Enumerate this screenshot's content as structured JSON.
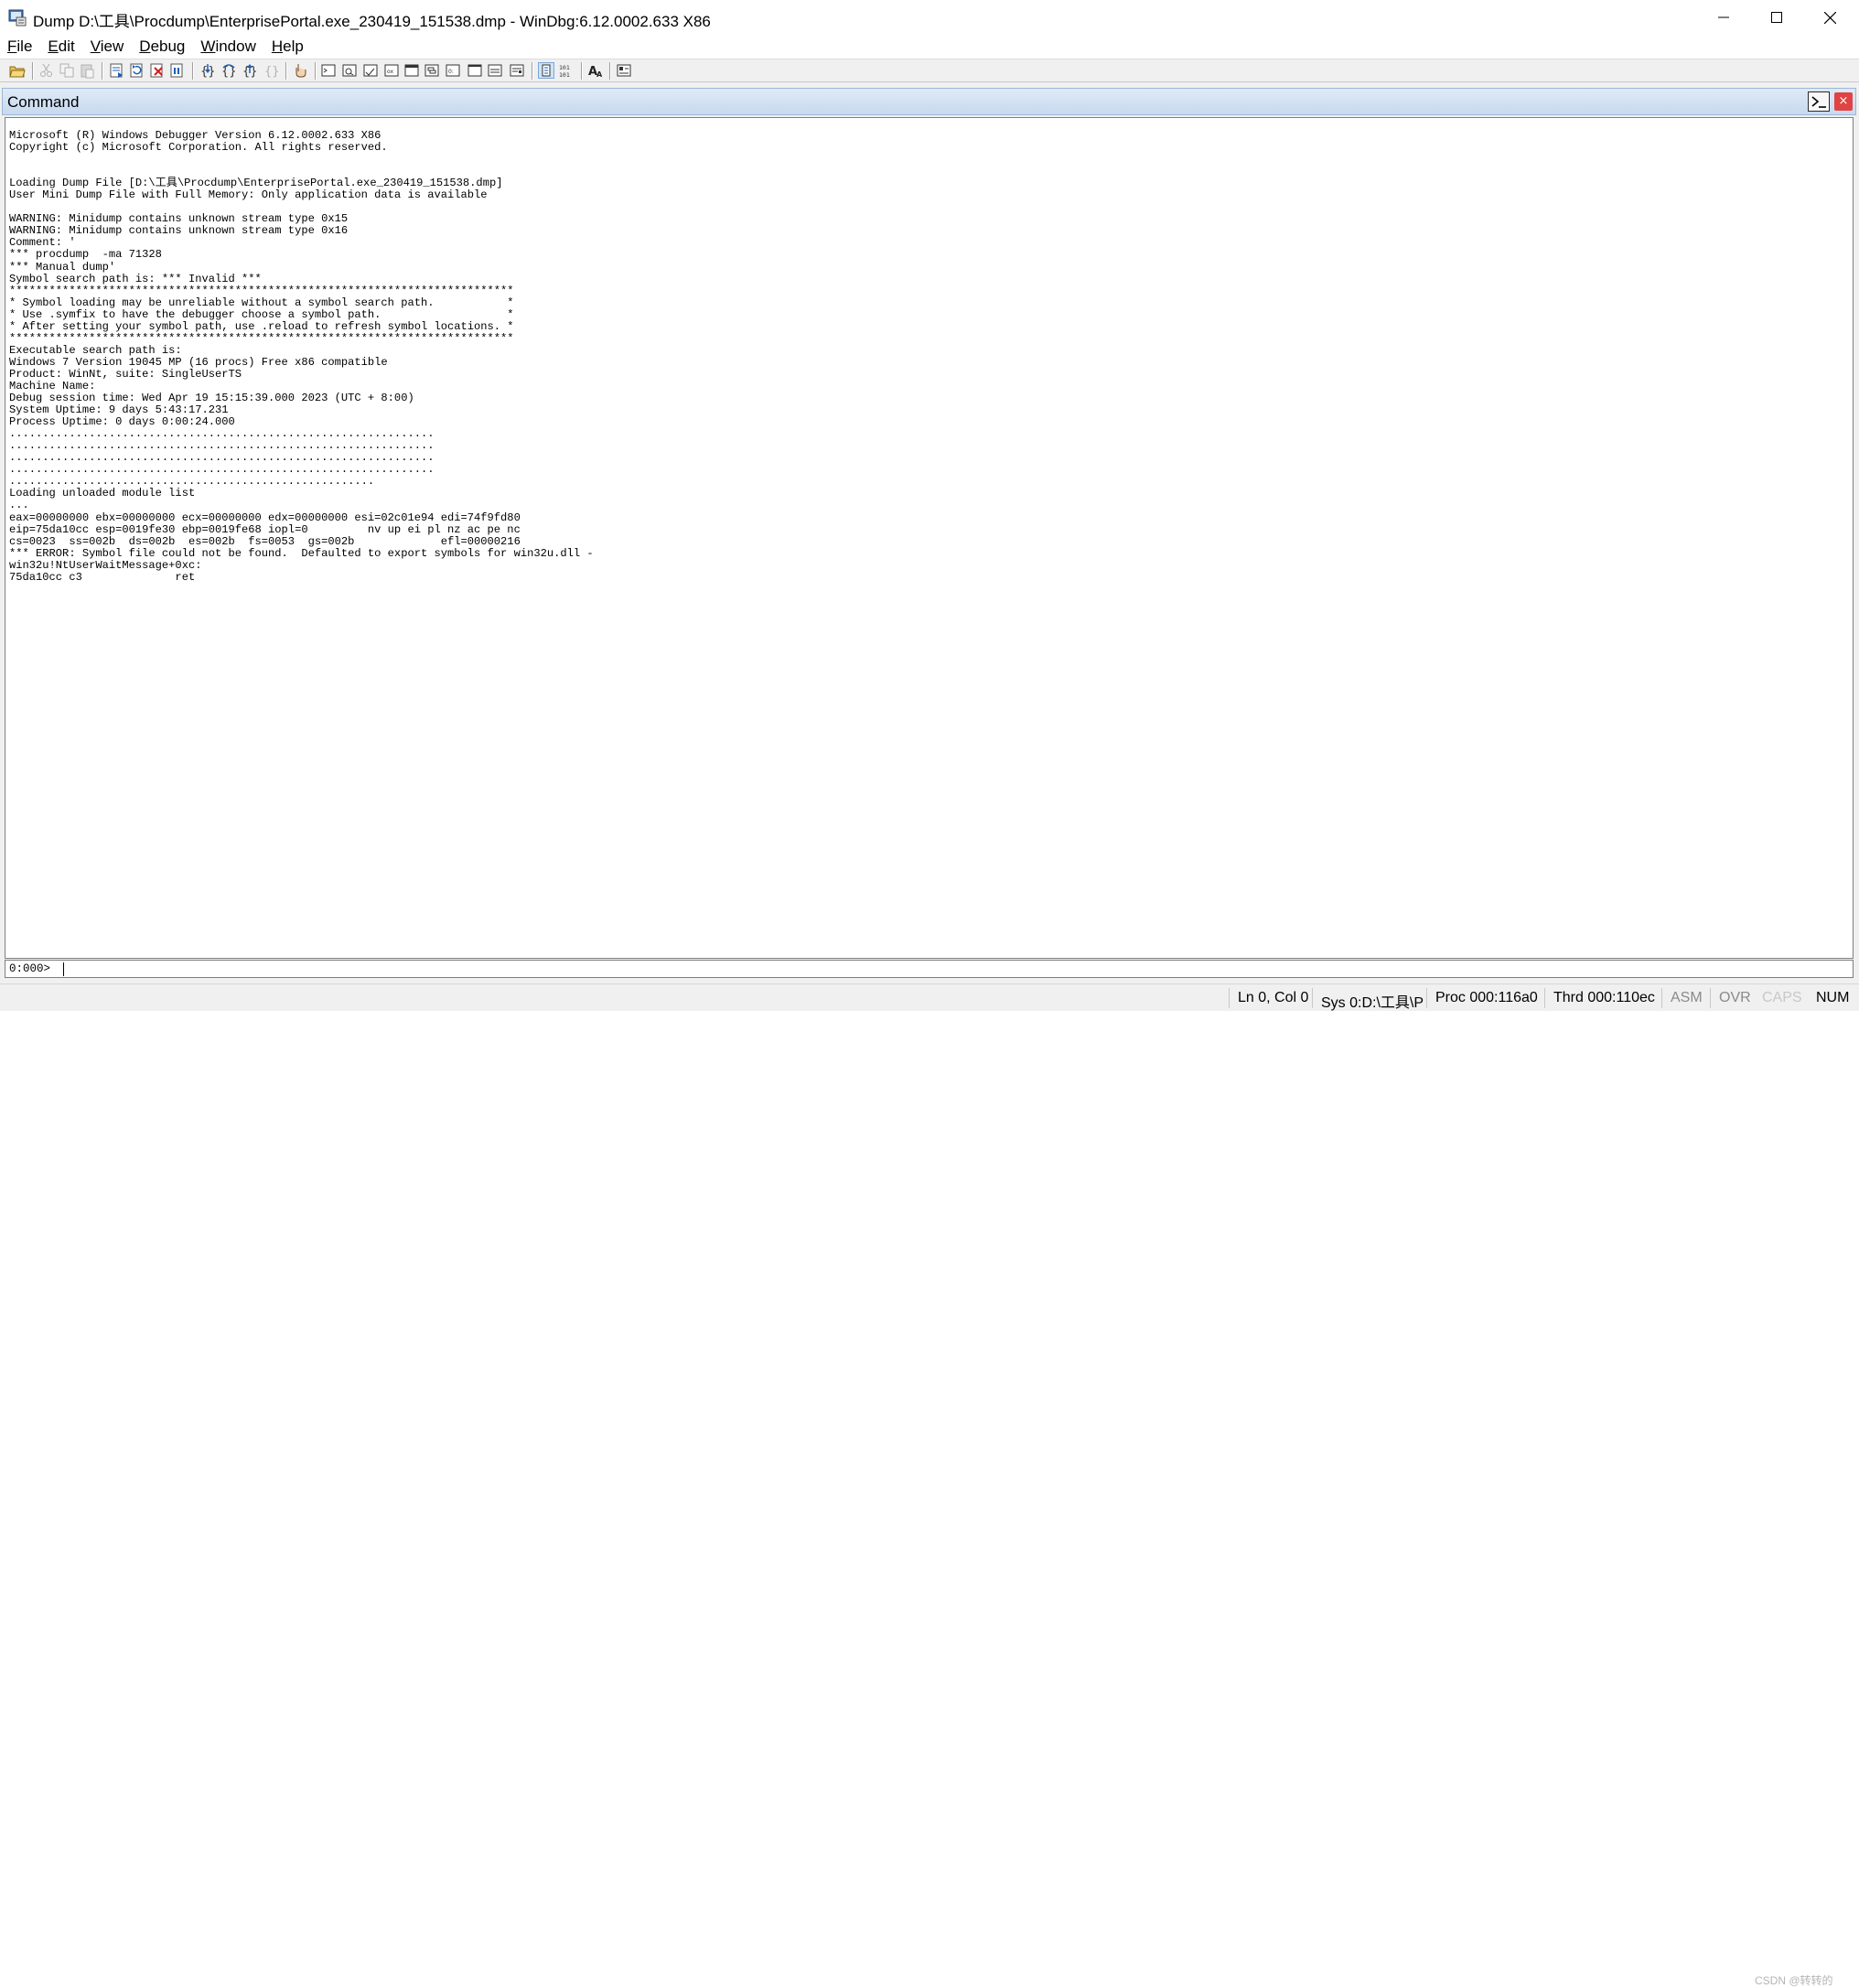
{
  "window": {
    "title": "Dump D:\\工具\\Procdump\\EnterprisePortal.exe_230419_151538.dmp - WinDbg:6.12.0002.633 X86"
  },
  "menu": [
    {
      "mnemonic": "F",
      "rest": "ile"
    },
    {
      "mnemonic": "E",
      "rest": "dit"
    },
    {
      "mnemonic": "V",
      "rest": "iew"
    },
    {
      "mnemonic": "D",
      "rest": "ebug"
    },
    {
      "mnemonic": "W",
      "rest": "indow"
    },
    {
      "mnemonic": "H",
      "rest": "elp"
    }
  ],
  "toolbar_icons": [
    "open-file-icon",
    "cut-icon",
    "copy-icon",
    "paste-icon",
    "go-icon",
    "restart-icon",
    "stop-debugging-icon",
    "break-icon",
    "step-into-icon",
    "step-over-icon",
    "step-out-icon",
    "run-to-cursor-icon",
    "insert-breakpoint-icon",
    "command-window-icon",
    "watch-window-icon",
    "locals-window-icon",
    "registers-window-icon",
    "memory-window-icon",
    "call-stack-window-icon",
    "disassembly-window-icon",
    "scratch-pad-icon",
    "processes-threads-icon",
    "source-mode-icon",
    "hex-mode-icon",
    "font-icon",
    "options-icon"
  ],
  "command_window": {
    "title": "Command",
    "close_glyph": "×",
    "output_lines": [
      "Microsoft (R) Windows Debugger Version 6.12.0002.633 X86",
      "Copyright (c) Microsoft Corporation. All rights reserved.",
      "",
      "",
      "Loading Dump File [D:\\工具\\Procdump\\EnterprisePortal.exe_230419_151538.dmp]",
      "User Mini Dump File with Full Memory: Only application data is available",
      "",
      "WARNING: Minidump contains unknown stream type 0x15",
      "WARNING: Minidump contains unknown stream type 0x16",
      "Comment: '",
      "*** procdump  -ma 71328",
      "*** Manual dump'",
      "Symbol search path is: *** Invalid ***",
      "****************************************************************************",
      "* Symbol loading may be unreliable without a symbol search path.           *",
      "* Use .symfix to have the debugger choose a symbol path.                   *",
      "* After setting your symbol path, use .reload to refresh symbol locations. *",
      "****************************************************************************",
      "Executable search path is:",
      "Windows 7 Version 19045 MP (16 procs) Free x86 compatible",
      "Product: WinNt, suite: SingleUserTS",
      "Machine Name:",
      "Debug session time: Wed Apr 19 15:15:39.000 2023 (UTC + 8:00)",
      "System Uptime: 9 days 5:43:17.231",
      "Process Uptime: 0 days 0:00:24.000",
      "................................................................",
      "................................................................",
      "................................................................",
      "................................................................",
      ".......................................................",
      "Loading unloaded module list",
      "...",
      "eax=00000000 ebx=00000000 ecx=00000000 edx=00000000 esi=02c01e94 edi=74f9fd80",
      "eip=75da10cc esp=0019fe30 ebp=0019fe68 iopl=0         nv up ei pl nz ac pe nc",
      "cs=0023  ss=002b  ds=002b  es=002b  fs=0053  gs=002b             efl=00000216",
      "*** ERROR: Symbol file could not be found.  Defaulted to export symbols for win32u.dll -",
      "win32u!NtUserWaitMessage+0xc:",
      "75da10cc c3              ret"
    ],
    "prompt": "0:000>",
    "input_value": ""
  },
  "status_bar": {
    "position": "Ln 0, Col 0",
    "sys": "Sys 0:D:\\工具\\P",
    "proc": "Proc 000:116a0",
    "thread": "Thrd 000:110ec",
    "asm": "ASM",
    "ovr": "OVR",
    "caps": "CAPS",
    "num": "NUM"
  },
  "watermark": "CSDN @转转的"
}
